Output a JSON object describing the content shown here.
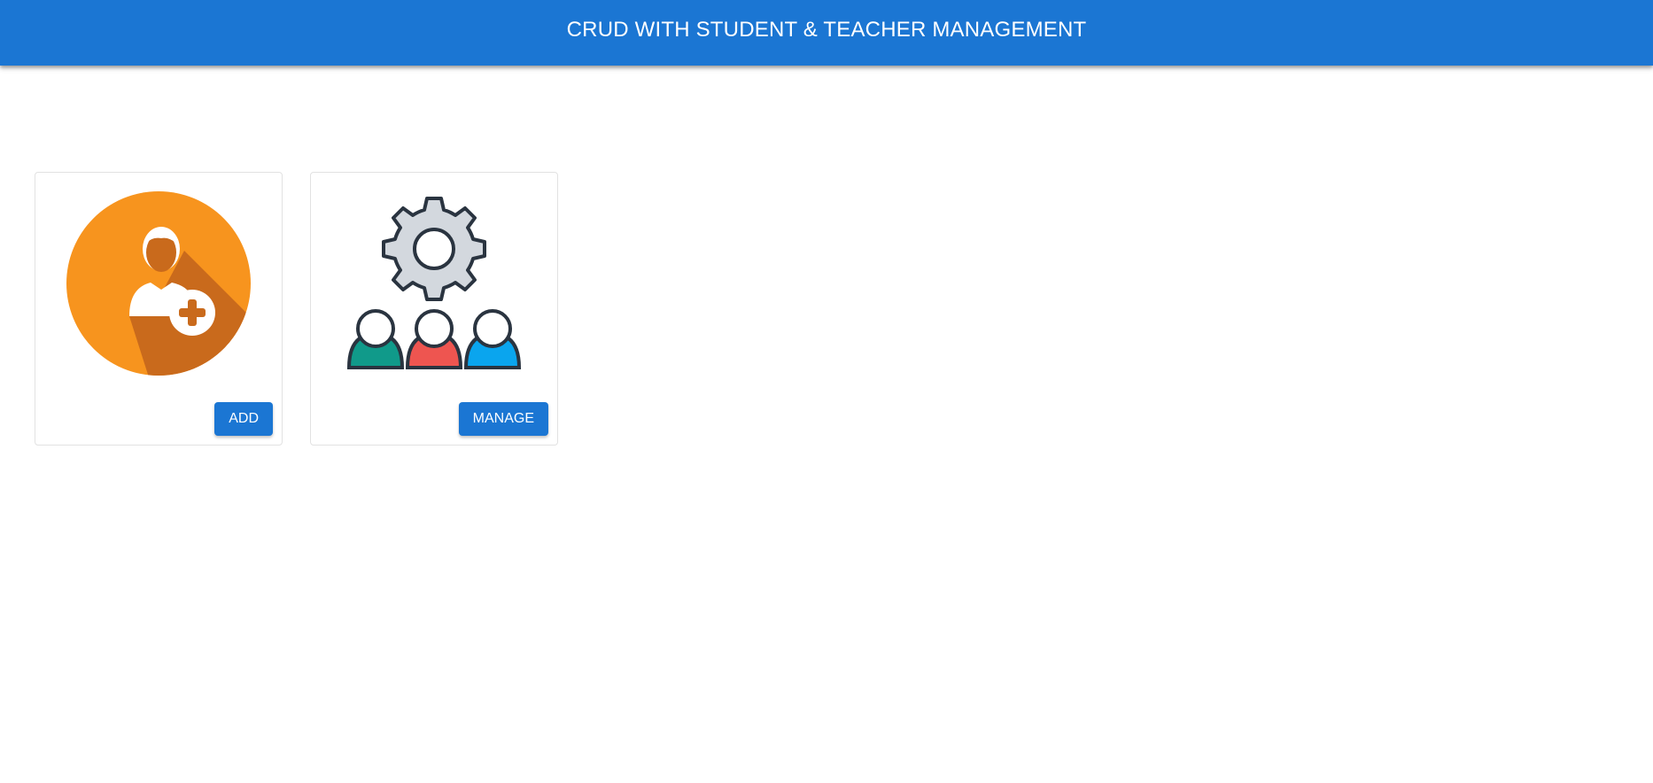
{
  "header": {
    "title": "CRUD WITH STUDENT & TEACHER MANAGEMENT",
    "color": "#1b76d3"
  },
  "cards": [
    {
      "icon": "add-user-icon",
      "icon_color": "#f7941e",
      "button_label": "ADD"
    },
    {
      "icon": "manage-users-gear-icon",
      "people_colors": [
        "#109a8a",
        "#ee5550",
        "#0aa5ee"
      ],
      "button_label": "MANAGE"
    }
  ]
}
